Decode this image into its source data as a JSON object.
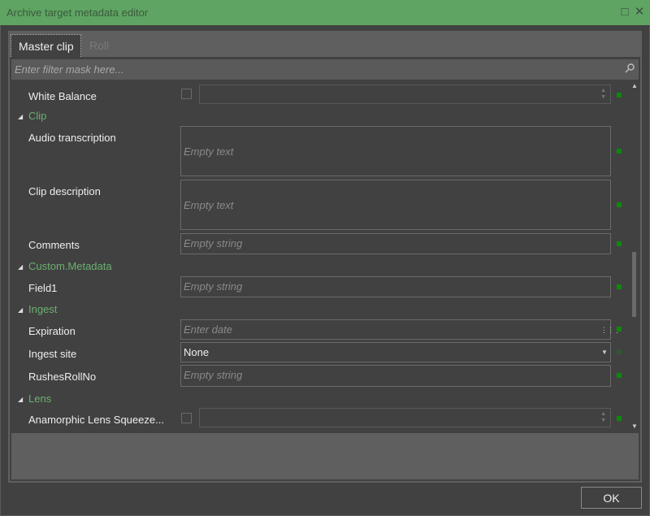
{
  "window": {
    "title": "Archive target metadata editor",
    "maximize_icon": "square",
    "close_icon": "x"
  },
  "tabs": [
    {
      "label": "Master clip",
      "active": true
    },
    {
      "label": "Roll",
      "active": false
    }
  ],
  "filter": {
    "placeholder": "Enter filter mask here...",
    "value": ""
  },
  "rows": {
    "white_balance": "White Balance",
    "clip_group": "Clip",
    "audio_transcription": {
      "label": "Audio transcription",
      "placeholder": "Empty text"
    },
    "clip_description": {
      "label": "Clip description",
      "placeholder": "Empty text"
    },
    "comments": {
      "label": "Comments",
      "placeholder": "Empty string"
    },
    "custom_group": "Custom.Metadata",
    "field1": {
      "label": "Field1",
      "placeholder": "Empty string"
    },
    "ingest_group": "Ingest",
    "expiration": {
      "label": "Expiration",
      "placeholder": "Enter date"
    },
    "ingest_site": {
      "label": "Ingest site",
      "value": "None"
    },
    "rushes": {
      "label": "RushesRollNo",
      "placeholder": "Empty string"
    },
    "lens_group": "Lens",
    "anamorphic": "Anamorphic Lens Squeeze..."
  },
  "colors": {
    "accent": "#5fa463",
    "indicator": "#0b8a0b",
    "group_text": "#6ab06e"
  },
  "ok_label": "OK"
}
